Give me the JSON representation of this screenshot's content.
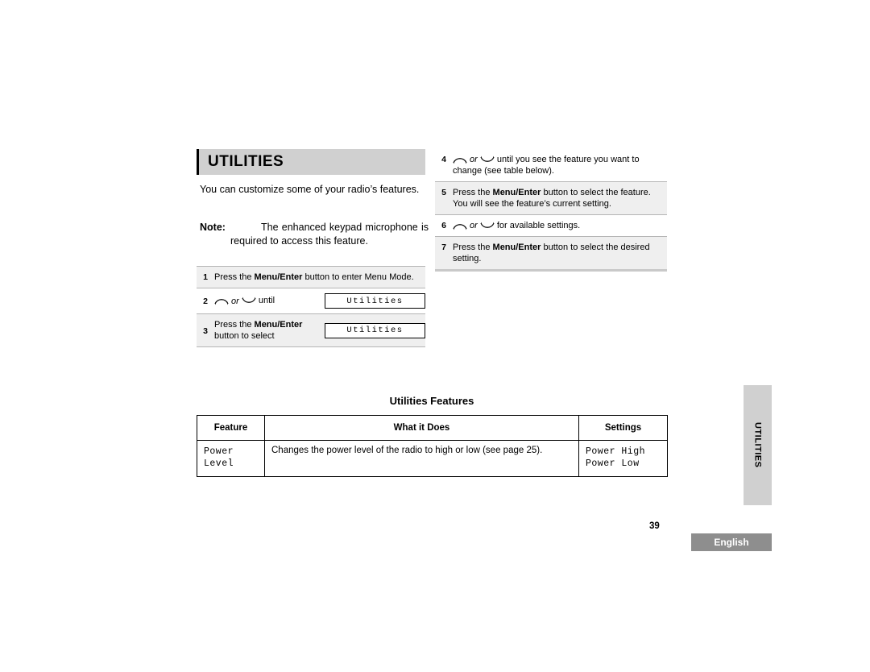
{
  "header": {
    "title": "UTILITIES"
  },
  "intro": {
    "paragraph": "You can customize some of your radio’s features.",
    "note_label": "Note:",
    "note_text": "The enhanced keypad microphone is required to access this feature."
  },
  "steps_left": [
    {
      "num": "1",
      "text_parts": [
        "Press the ",
        "Menu/Enter",
        " button to enter Menu Mode."
      ],
      "has_lcd": false,
      "lcd": ""
    },
    {
      "num": "2",
      "text_parts": [
        "",
        "",
        " until"
      ],
      "nav": true,
      "or_label": "or",
      "has_lcd": true,
      "lcd": "Utilities"
    },
    {
      "num": "3",
      "text_parts": [
        "Press the ",
        "Menu/Enter",
        " button to select"
      ],
      "has_lcd": true,
      "lcd": "Utilities"
    }
  ],
  "steps_right": [
    {
      "num": "4",
      "nav": true,
      "or_label": "or",
      "text": "until you see the feature you want to change (see table below)."
    },
    {
      "num": "5",
      "prefix": "Press the ",
      "bold": "Menu/Enter",
      "suffix": " button to select the feature. You will see the feature’s current setting."
    },
    {
      "num": "6",
      "nav": true,
      "or_label": "or",
      "text": "for available settings."
    },
    {
      "num": "7",
      "prefix": "Press the ",
      "bold": "Menu/Enter",
      "suffix": " button to select the desired setting."
    }
  ],
  "features_table": {
    "caption": "Utilities Features",
    "headers": [
      "Feature",
      "What it Does",
      "Settings"
    ],
    "rows": [
      {
        "feature": "Power\nLevel",
        "what": "Changes the power level of the radio to high or low (see page 25).",
        "settings": "Power High\nPower Low"
      }
    ]
  },
  "side_tab": {
    "label": "UTILITIES"
  },
  "footer": {
    "page_number": "39",
    "language": "English"
  },
  "colors": {
    "title_bar": "#d0d0d0",
    "shade_row": "#efefef",
    "side_tab": "#d0d0d0",
    "lang_tab": "#8e8e8e"
  },
  "icons": {
    "up_arrow": "nav-up-icon",
    "down_arrow": "nav-down-icon"
  }
}
